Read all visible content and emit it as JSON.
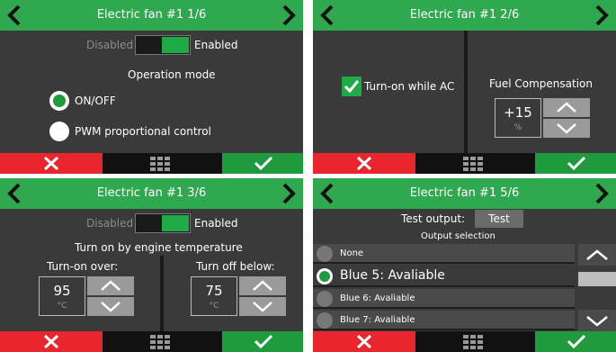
{
  "colors": {
    "header": "#2fa84f",
    "cancel": "#e8262b",
    "confirm": "#1f9a3c",
    "panel": "#3a3a3a",
    "toggle_on": "#1faa48"
  },
  "icons": {
    "prev": "chevron-left-icon",
    "next": "chevron-right-icon",
    "cancel": "close-icon",
    "confirm": "checkmark-icon",
    "menu": "grid-menu-icon"
  },
  "panel1": {
    "title": "Electric fan #1 1/6",
    "toggle_off_label": "Disabled",
    "toggle_on_label": "Enabled",
    "toggle_state": "on",
    "section_label": "Operation mode",
    "options": [
      "ON/OFF",
      "PWM proportional control"
    ],
    "selected_option": "ON/OFF"
  },
  "panel2": {
    "title": "Electric fan #1 2/6",
    "checkbox_label": "Turn-on while AC",
    "checkbox_checked": true,
    "fuel_label": "Fuel Compensation",
    "fuel_value": "+15",
    "fuel_unit": "%"
  },
  "panel3": {
    "title": "Electric fan #1 3/6",
    "toggle_off_label": "Disabled",
    "toggle_on_label": "Enabled",
    "toggle_state": "on",
    "section_label": "Turn on by engine temperature",
    "turn_on_label": "Turn-on over:",
    "turn_on_value": "95",
    "turn_on_unit": "°C",
    "turn_off_label": "Turn off below:",
    "turn_off_value": "75",
    "turn_off_unit": "°C"
  },
  "panel4": {
    "title": "Electric fan #1 5/6",
    "test_label": "Test output:",
    "test_button": "Test",
    "output_label": "Output selection",
    "outputs": [
      "None",
      "Blue 5: Avaliable",
      "Blue 6: Avaliable",
      "Blue 7: Avaliable"
    ],
    "selected_output": "Blue 5: Avaliable"
  }
}
